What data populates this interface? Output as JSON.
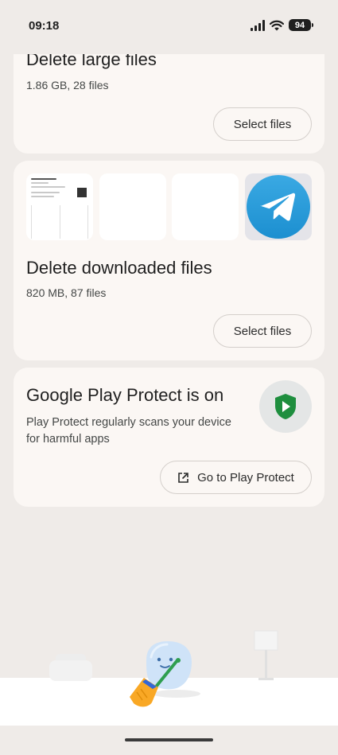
{
  "status_bar": {
    "time": "09:18",
    "battery": "94"
  },
  "large_files_card": {
    "title": "Delete large files",
    "subtitle": "1.86 GB, 28 files",
    "button_label": "Select files"
  },
  "downloaded_files_card": {
    "title": "Delete downloaded files",
    "subtitle": "820 MB, 87 files",
    "button_label": "Select files",
    "thumbnails": [
      "document-thumbnail",
      "blank-thumbnail",
      "blank-thumbnail",
      "telegram-icon"
    ]
  },
  "play_protect_card": {
    "title": "Google Play Protect is on",
    "description_line1": "Play Protect regularly scans your device",
    "description_line2": "for harmful apps",
    "button_label": "Go to Play Protect",
    "icon": "play-protect-shield-icon"
  },
  "colors": {
    "background": "#efebe8",
    "card": "#fbf7f4",
    "shield_green": "#1e8e3e",
    "telegram_blue": "#2aa3e0",
    "broom_orange": "#f9a825"
  }
}
